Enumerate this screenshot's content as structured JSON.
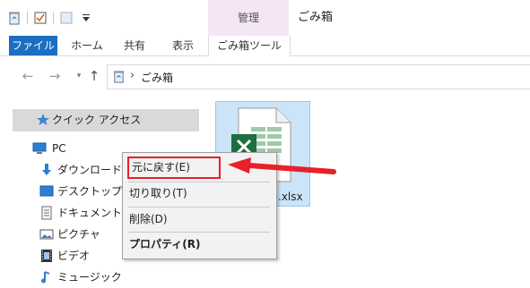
{
  "window": {
    "title": "ごみ箱",
    "manage_tab": "管理"
  },
  "ribbon": {
    "tabs": [
      "ファイル",
      "ホーム",
      "共有",
      "表示",
      "ごみ箱ツール"
    ]
  },
  "address": {
    "location": "ごみ箱",
    "separator": "›"
  },
  "sidebar": {
    "items": [
      {
        "label": "クイック アクセス",
        "icon": "star-icon"
      },
      {
        "label": "PC",
        "icon": "pc-icon"
      },
      {
        "label": "ダウンロード",
        "icon": "download-icon"
      },
      {
        "label": "デスクトップ",
        "icon": "desktop-icon"
      },
      {
        "label": "ドキュメント",
        "icon": "document-icon"
      },
      {
        "label": "ピクチャ",
        "icon": "pictures-icon"
      },
      {
        "label": "ビデオ",
        "icon": "video-icon"
      },
      {
        "label": "ミュージック",
        "icon": "music-icon"
      }
    ]
  },
  "file": {
    "name_visible": "料.xlsx",
    "icon": "excel-file-icon"
  },
  "context_menu": {
    "items": [
      {
        "label": "元に戻す(E)"
      },
      {
        "label": "切り取り(T)"
      },
      {
        "label": "削除(D)"
      },
      {
        "label": "プロパティ(R)"
      }
    ]
  },
  "colors": {
    "file_tab": "#1a6fc0",
    "manage_tab": "#f4e6f4",
    "selection": "#cce4f7",
    "highlight": "#e8202a"
  }
}
